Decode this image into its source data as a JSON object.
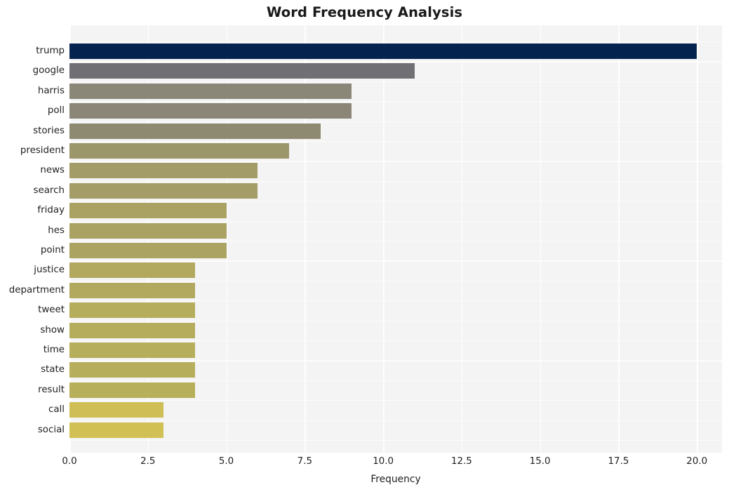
{
  "chart_data": {
    "type": "bar",
    "orientation": "horizontal",
    "title": "Word Frequency Analysis",
    "xlabel": "Frequency",
    "ylabel": "",
    "xlim": [
      0,
      20.8
    ],
    "ylim_note": "categorical, 20 words ordered descending by frequency",
    "xticks": [
      "0.0",
      "2.5",
      "5.0",
      "7.5",
      "10.0",
      "12.5",
      "15.0",
      "17.5",
      "20.0"
    ],
    "xtick_values": [
      0,
      2.5,
      5,
      7.5,
      10,
      12.5,
      15,
      17.5,
      20
    ],
    "grid": true,
    "legend": null,
    "categories": [
      "trump",
      "google",
      "harris",
      "poll",
      "stories",
      "president",
      "news",
      "search",
      "friday",
      "hes",
      "point",
      "justice",
      "department",
      "tweet",
      "show",
      "time",
      "state",
      "result",
      "call",
      "social"
    ],
    "values": [
      20,
      11,
      9,
      9,
      8,
      7,
      6,
      6,
      5,
      5,
      5,
      4,
      4,
      4,
      4,
      4,
      4,
      4,
      3,
      3
    ],
    "bar_colors": [
      "#05234f",
      "#706f73",
      "#8a8779",
      "#8b8678",
      "#8e8a71",
      "#9c966b",
      "#a39c68",
      "#a49d67",
      "#aaa263",
      "#aaa263",
      "#aba362",
      "#b2a95f",
      "#b2a95f",
      "#b6ad5c",
      "#b6ad5c",
      "#b7ae5b",
      "#b7ae5b",
      "#b8af5b",
      "#cfbe56",
      "#d1c054"
    ],
    "plot_background": "#f4f4f5",
    "gridline_color": "#ffffff",
    "figure_background": "#ffffff"
  }
}
